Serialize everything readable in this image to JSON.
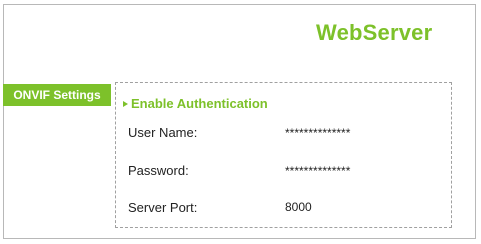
{
  "header": {
    "title": "WebServer"
  },
  "section": {
    "tab_label": "ONVIF Settings",
    "heading": "Enable Authentication"
  },
  "fields": {
    "username": {
      "label": "User Name:",
      "value": "**************"
    },
    "password": {
      "label": "Password:",
      "value": "**************"
    },
    "server_port": {
      "label": "Server Port:",
      "value": "8000"
    }
  },
  "colors": {
    "accent": "#7dc12a",
    "border": "#a0a0a0",
    "text": "#222222"
  }
}
